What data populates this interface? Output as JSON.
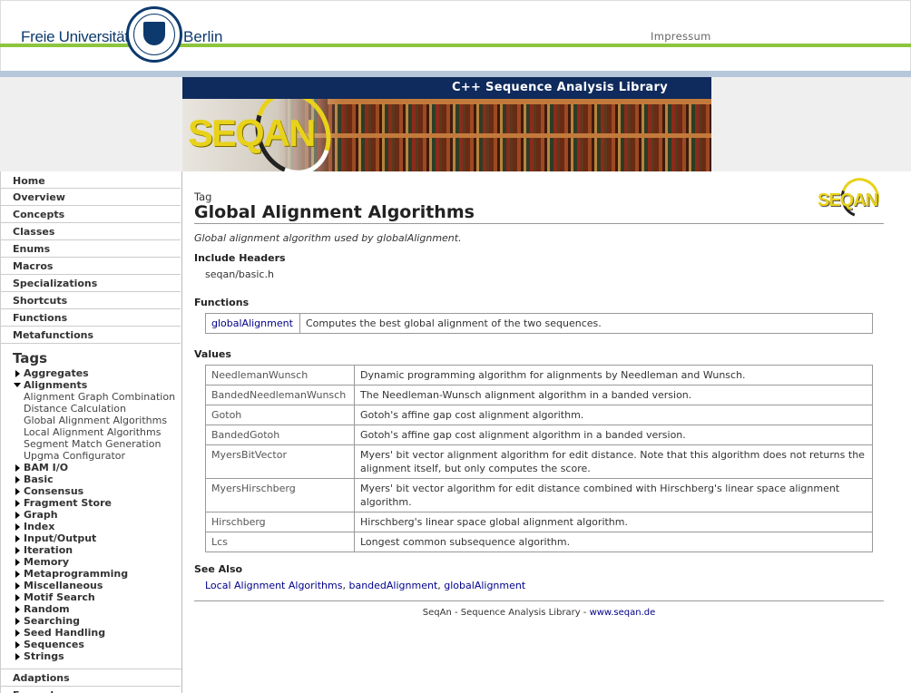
{
  "header": {
    "brand_left": "Freie Universität",
    "brand_right": "Berlin",
    "seal_name": "fu-berlin-seal",
    "impressum": "Impressum"
  },
  "banner": {
    "title": "C++ Sequence Analysis Library",
    "logo": "SEQAN"
  },
  "sidebar": {
    "top_items": [
      "Home",
      "Overview",
      "Concepts",
      "Classes",
      "Enums",
      "Macros",
      "Specializations",
      "Shortcuts",
      "Functions",
      "Metafunctions"
    ],
    "tags_heading": "Tags",
    "tags_before": [
      "Aggregates"
    ],
    "expanded_tag": "Alignments",
    "expanded_children": [
      "Alignment Graph Combination",
      "Distance Calculation",
      "Global Alignment Algorithms",
      "Local Alignment Algorithms",
      "Segment Match Generation",
      "Upgma Configurator"
    ],
    "tags_after": [
      "BAM I/O",
      "Basic",
      "Consensus",
      "Fragment Store",
      "Graph",
      "Index",
      "Input/Output",
      "Iteration",
      "Memory",
      "Metaprogramming",
      "Miscellaneous",
      "Motif Search",
      "Random",
      "Searching",
      "Seed Handling",
      "Sequences",
      "Strings"
    ],
    "bottom_items": [
      "Adaptions",
      "Examples"
    ]
  },
  "content": {
    "kind": "Tag",
    "title": "Global Alignment Algorithms",
    "description": "Global alignment algorithm used by globalAlignment.",
    "include_label": "Include Headers",
    "include_value": "seqan/basic.h",
    "functions_label": "Functions",
    "functions": [
      {
        "name": "globalAlignment",
        "desc": "Computes the best global alignment of the two sequences."
      }
    ],
    "values_label": "Values",
    "values": [
      {
        "name": "NeedlemanWunsch",
        "desc": "Dynamic programming algorithm for alignments by Needleman and Wunsch."
      },
      {
        "name": "BandedNeedlemanWunsch",
        "desc": "The Needleman-Wunsch alignment algorithm in a banded version."
      },
      {
        "name": "Gotoh",
        "desc": "Gotoh's affine gap cost alignment algorithm."
      },
      {
        "name": "BandedGotoh",
        "desc": "Gotoh's affine gap cost alignment algorithm in a banded version."
      },
      {
        "name": "MyersBitVector",
        "desc": "Myers' bit vector alignment algorithm for edit distance. Note that this algorithm does not returns the alignment itself, but only computes the score."
      },
      {
        "name": "MyersHirschberg",
        "desc": "Myers' bit vector algorithm for edit distance combined with Hirschberg's linear space alignment algorithm."
      },
      {
        "name": "Hirschberg",
        "desc": "Hirschberg's linear space global alignment algorithm."
      },
      {
        "name": "Lcs",
        "desc": "Longest common subsequence algorithm."
      }
    ],
    "see_also_label": "See Also",
    "see_also": [
      "Local Alignment Algorithms",
      "bandedAlignment",
      "globalAlignment"
    ],
    "see_also_separator": ", ",
    "footer_text": "SeqAn - Sequence Analysis Library - ",
    "footer_link": "www.seqan.de"
  },
  "colors": {
    "brand_blue": "#0d3a6e",
    "green_bar": "#8dc53e",
    "banner_navy": "#0f2a5c",
    "logo_yellow": "#e8d21a",
    "link": "#00008b"
  }
}
